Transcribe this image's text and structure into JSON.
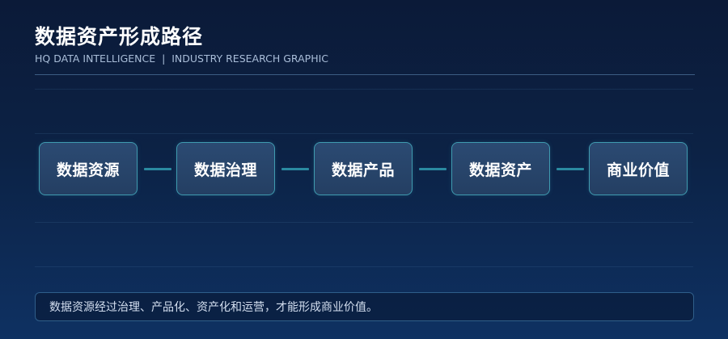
{
  "header": {
    "title": "数据资产形成路径",
    "subtitle": "HQ DATA INTELLIGENCE  |  INDUSTRY RESEARCH GRAPHIC"
  },
  "flow": {
    "steps": [
      {
        "label": "数据资源"
      },
      {
        "label": "数据治理"
      },
      {
        "label": "数据产品"
      },
      {
        "label": "数据资产"
      },
      {
        "label": "商业价值"
      }
    ]
  },
  "note": {
    "text": "数据资源经过治理、产品化、资产化和运营，才能形成商业价值。"
  },
  "colors": {
    "background_top": "#0b1a38",
    "background_bottom": "#0e3162",
    "box_fill": "#2b4a72",
    "box_border": "#3f9bb0",
    "connector": "#2a8aa0"
  }
}
